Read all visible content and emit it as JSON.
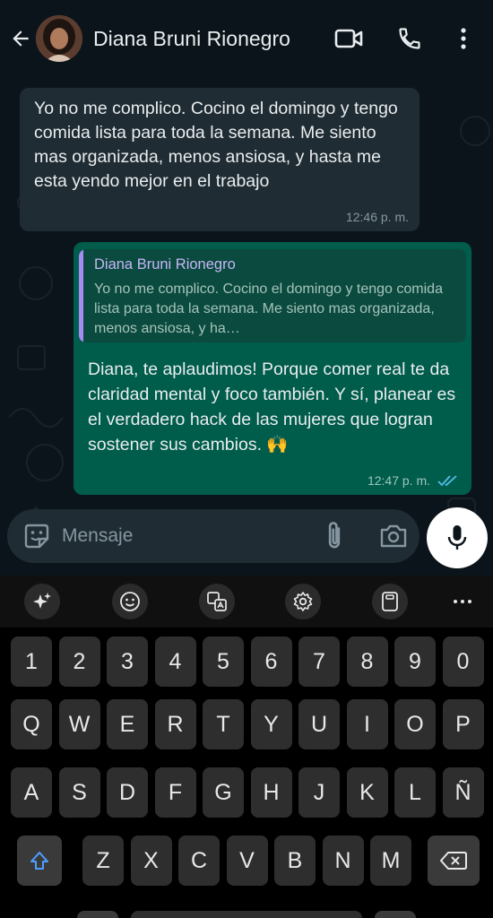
{
  "header": {
    "contact_name": "Diana Bruni Rionegro",
    "icons": [
      "back-arrow-icon",
      "video-call-icon",
      "phone-icon",
      "more-vert-icon"
    ]
  },
  "messages": {
    "incoming": {
      "text": "Yo no me complico. Cocino el domingo y tengo comida lista para toda la semana. Me siento mas organizada, menos ansiosa, y hasta me esta yendo mejor en el trabajo",
      "time": "12:46 p. m."
    },
    "outgoing": {
      "quote_author": "Diana Bruni Rionegro",
      "quote_text": "Yo no me complico. Cocino el domingo y tengo comida lista para toda la semana. Me siento mas organizada, menos ansiosa, y ha…",
      "text": "Diana, te aplaudimos! Porque comer real te da claridad mental y foco también. Y sí, planear es el verdadero hack de las mujeres que logran sostener sus cambios. 🙌",
      "time": "12:47 p. m.",
      "status": "read"
    }
  },
  "composer": {
    "placeholder": "Mensaje"
  },
  "keyboard": {
    "row_numbers": [
      "1",
      "2",
      "3",
      "4",
      "5",
      "6",
      "7",
      "8",
      "9",
      "0"
    ],
    "row_1": [
      "Q",
      "W",
      "E",
      "R",
      "T",
      "Y",
      "U",
      "I",
      "O",
      "P"
    ],
    "row_2": [
      "A",
      "S",
      "D",
      "F",
      "G",
      "H",
      "J",
      "K",
      "L",
      "Ñ"
    ],
    "row_3": [
      "Z",
      "X",
      "C",
      "V",
      "B",
      "N",
      "M"
    ]
  },
  "colors": {
    "background": "#0b141a",
    "incoming_bubble": "#1f2c33",
    "outgoing_bubble": "#005c4b",
    "quote_accent": "#a58bf2",
    "read_ticks": "#53bdeb"
  }
}
